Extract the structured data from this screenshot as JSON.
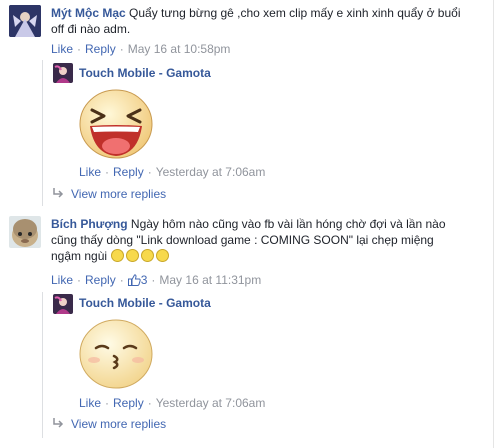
{
  "comments": [
    {
      "author": "Mýt Mộc Mạc",
      "text_line1": "Quẩy tưng bừng gê ,cho xem clip mấy e xinh xinh quẩy ở buổi",
      "text_line2": "off đi nào adm.",
      "like": "Like",
      "reply": "Reply",
      "timestamp": "May 16 at 10:58pm",
      "reply_item": {
        "author": "Touch Mobile - Gamota",
        "sticker": "laughing-face-sticker",
        "like": "Like",
        "reply": "Reply",
        "timestamp": "Yesterday at 7:06am"
      },
      "view_more": "View more replies"
    },
    {
      "author": "Bích Phượng",
      "text_line1": "Ngày hôm nào cũng vào fb vài lần hóng chờ đợi và lần nào",
      "text_line2": "cũng thấy dòng \"Link download game : COMING SOON\" lại chẹp miệng",
      "text_line3": "ngậm ngùi",
      "like": "Like",
      "reply": "Reply",
      "like_count": "3",
      "timestamp": "May 16 at 11:31pm",
      "reply_item": {
        "author": "Touch Mobile - Gamota",
        "sticker": "kissing-face-sticker",
        "like": "Like",
        "reply": "Reply",
        "timestamp": "Yesterday at 7:06am"
      },
      "view_more": "View more replies"
    }
  ],
  "colors": {
    "link": "#365899",
    "action": "#4267b2",
    "meta": "#90949c",
    "text": "#1d2129"
  }
}
